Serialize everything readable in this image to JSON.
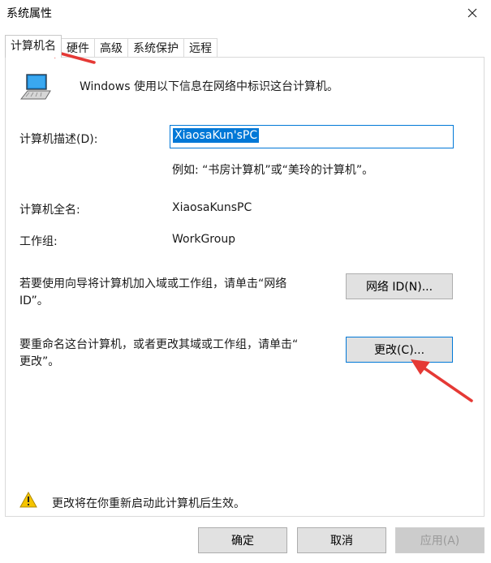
{
  "window": {
    "title": "系统属性"
  },
  "tabs": [
    {
      "label": "计算机名"
    },
    {
      "label": "硬件"
    },
    {
      "label": "高级"
    },
    {
      "label": "系统保护"
    },
    {
      "label": "远程"
    }
  ],
  "intro": "Windows 使用以下信息在网络中标识这台计算机。",
  "description": {
    "label": "计算机描述(D):",
    "value": "XiaosaKun'sPC",
    "example": "例如: “书房计算机”或“美玲的计算机”。"
  },
  "full_name": {
    "label": "计算机全名:",
    "value": "XiaosaKunsPC"
  },
  "workgroup": {
    "label": "工作组:",
    "value": "WorkGroup"
  },
  "network_id": {
    "text_line1": "若要使用向导将计算机加入域或工作组，请单击“网络",
    "text_line2": "ID”。",
    "button": "网络 ID(N)..."
  },
  "change": {
    "text_line1": "要重命名这台计算机，或者更改其域或工作组，请单击“",
    "text_line2": "更改”。",
    "button": "更改(C)..."
  },
  "warning": "更改将在你重新启动此计算机后生效。",
  "footer": {
    "ok": "确定",
    "cancel": "取消",
    "apply": "应用(A)"
  },
  "annotation_color": "#e53935"
}
